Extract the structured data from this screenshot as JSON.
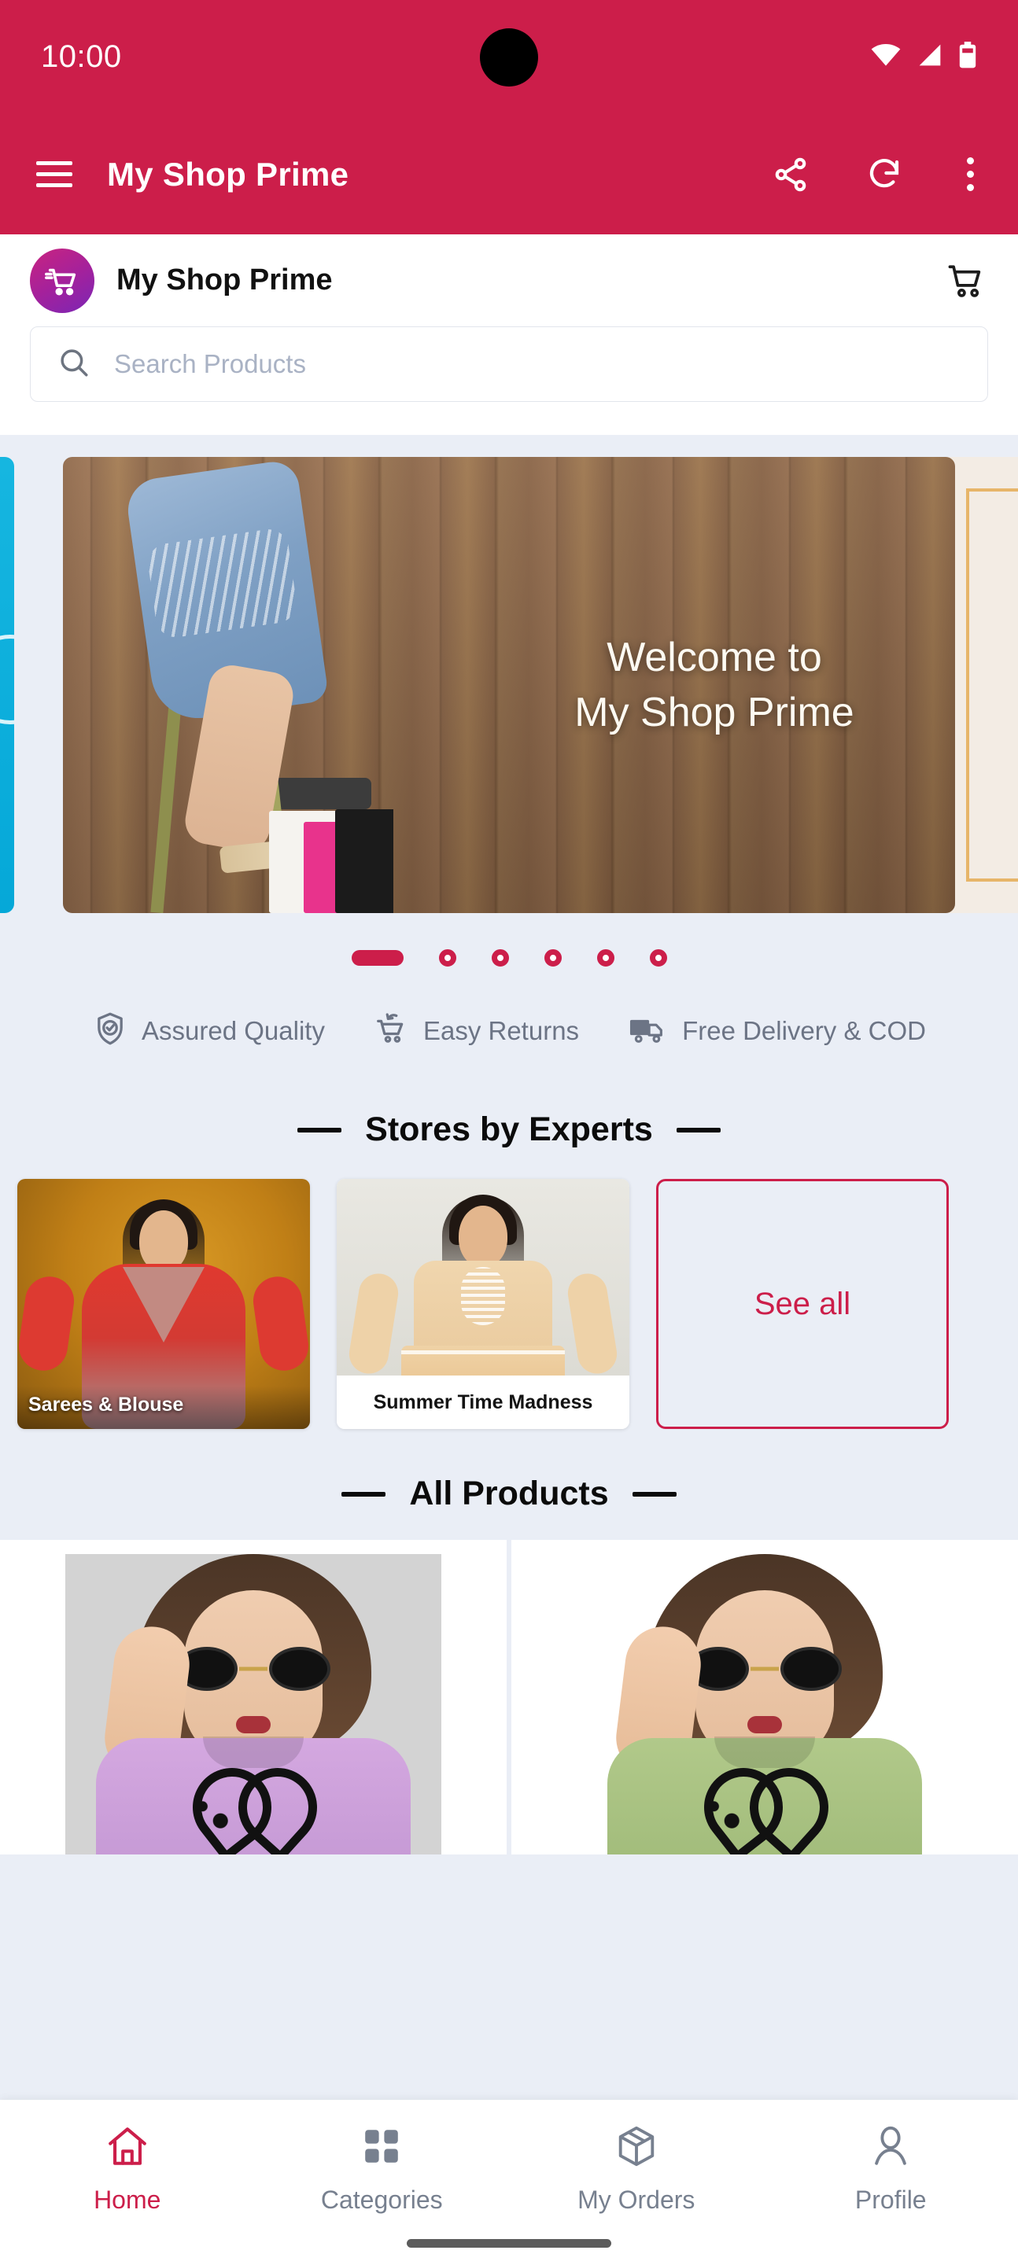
{
  "status_bar": {
    "time": "10:00",
    "icons": [
      "wifi-icon",
      "cellular-signal-icon",
      "battery-icon"
    ]
  },
  "app_bar": {
    "menu_icon": "hamburger-menu-icon",
    "title": "My Shop Prime",
    "actions": [
      {
        "icon": "share-icon",
        "name": "share-button"
      },
      {
        "icon": "refresh-icon",
        "name": "refresh-button"
      },
      {
        "icon": "overflow-menu-icon",
        "name": "overflow-menu-button"
      }
    ]
  },
  "brand_header": {
    "logo_icon": "shopping-cart-logo-icon",
    "name": "My Shop Prime",
    "cart_icon": "shopping-cart-icon"
  },
  "search": {
    "icon": "search-icon",
    "placeholder": "Search Products",
    "value": ""
  },
  "carousel": {
    "banner_text": "Welcome to\nMy Shop Prime",
    "active_index": 0,
    "total_slides": 6,
    "prev_peek_color": "#0aa9d8",
    "next_peek_color": "#f3ece4",
    "accent": "#cc1e4a"
  },
  "trust_badges": [
    {
      "icon": "shield-check-icon",
      "label": "Assured Quality"
    },
    {
      "icon": "return-cart-icon",
      "label": "Easy Returns"
    },
    {
      "icon": "delivery-truck-icon",
      "label": "Free Delivery & COD"
    }
  ],
  "stores_section": {
    "title": "Stores by Experts",
    "cards": [
      {
        "label": "Sarees & Blouse",
        "label_style": "overlay"
      },
      {
        "label": "Summer Time Madness",
        "label_style": "band"
      }
    ],
    "see_all_label": "See all"
  },
  "products_section": {
    "title": "All Products",
    "items": [
      {
        "name": "printed-tshirt-lavender",
        "shirt_color": "#c79bd6",
        "bg": "#d3d3d3"
      },
      {
        "name": "printed-tshirt-green",
        "shirt_color": "#a3bd7c",
        "bg": "#ffffff"
      }
    ]
  },
  "bottom_nav": {
    "active": "Home",
    "items": [
      {
        "icon": "home-icon",
        "label": "Home"
      },
      {
        "icon": "grid-categories-icon",
        "label": "Categories"
      },
      {
        "icon": "package-box-icon",
        "label": "My Orders"
      },
      {
        "icon": "person-profile-icon",
        "label": "Profile"
      }
    ]
  },
  "colors": {
    "brand_crimson": "#cc1e4a",
    "page_bg": "#eaeef6",
    "muted_text": "#6c7485"
  }
}
